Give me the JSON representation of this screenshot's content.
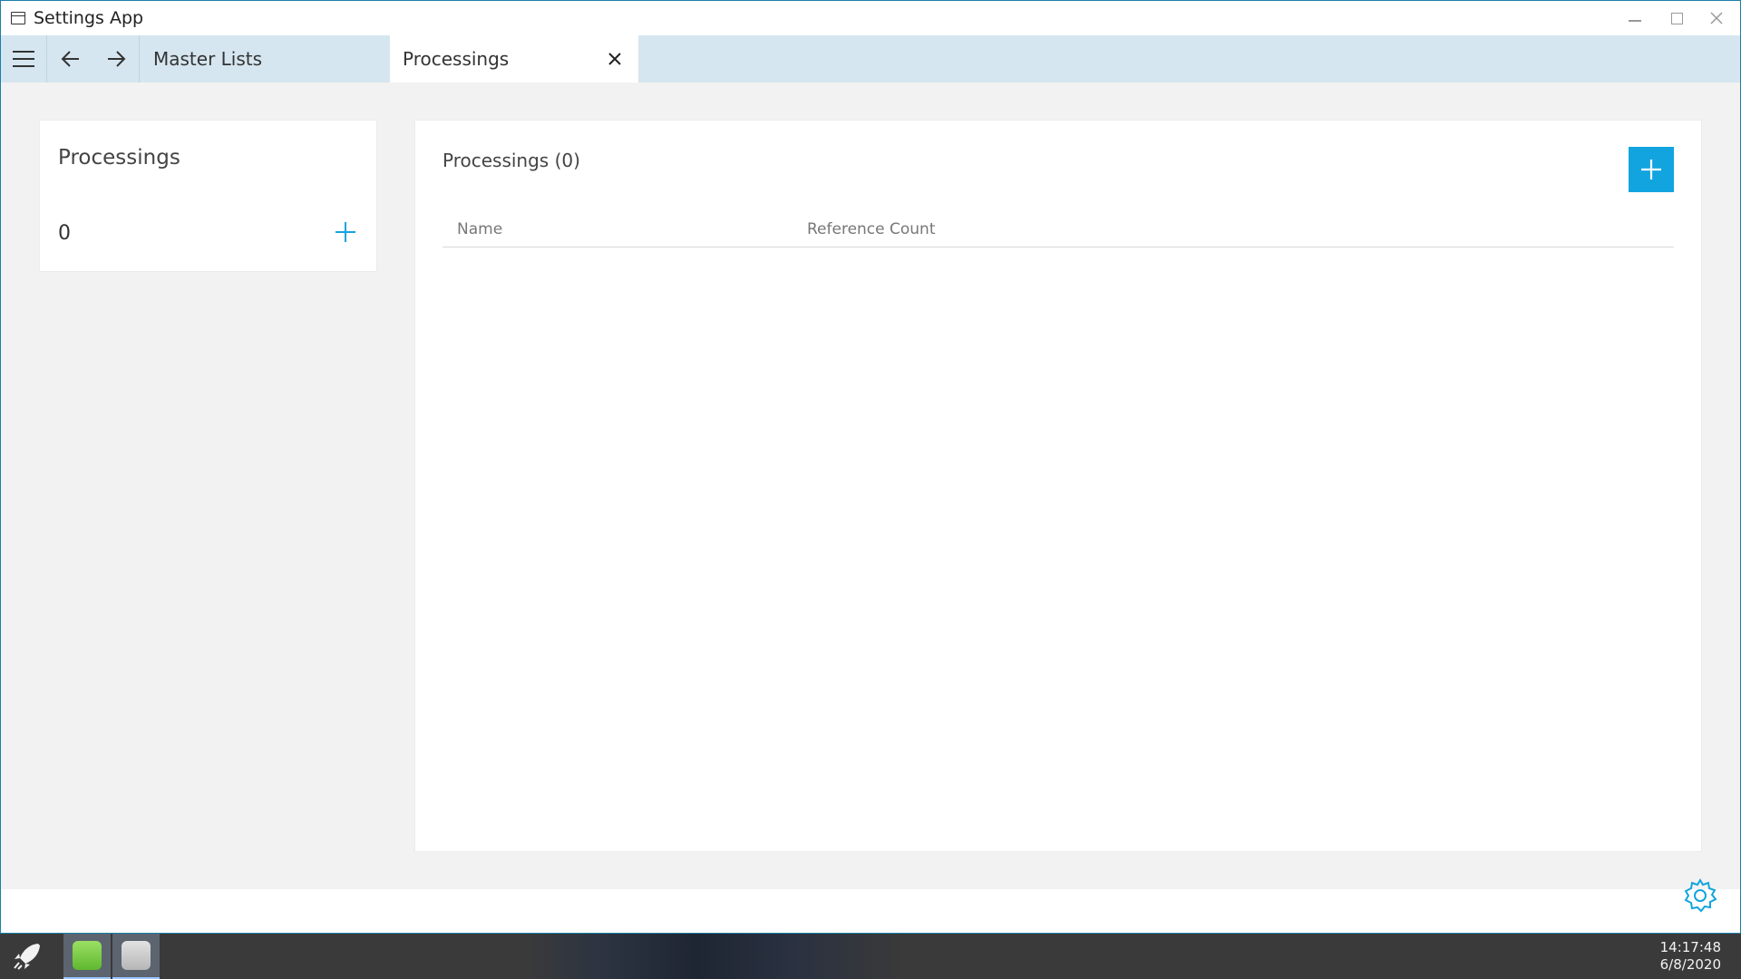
{
  "window": {
    "title": "Settings App"
  },
  "tabs": [
    {
      "label": "Master Lists"
    },
    {
      "label": "Processings"
    }
  ],
  "left_card": {
    "heading": "Processings",
    "count": "0"
  },
  "panel": {
    "heading": "Processings (0)",
    "columns": [
      "Name",
      "Reference Count"
    ]
  },
  "taskbar": {
    "time": "14:17:48",
    "date": "6/8/2020"
  },
  "colors": {
    "accent": "#12a4df",
    "tabbar": "#d6e6f0",
    "background": "#f2f2f2"
  },
  "icons": [
    "app-window-icon",
    "hamburger-menu-icon",
    "arrow-left-icon",
    "arrow-right-icon",
    "close-icon",
    "plus-icon",
    "gear-icon",
    "rocket-icon"
  ]
}
